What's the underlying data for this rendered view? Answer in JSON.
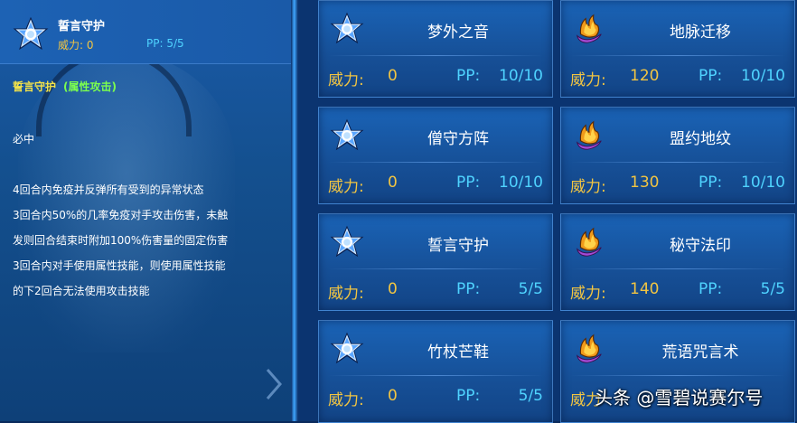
{
  "detail": {
    "skill_name": "誓言守护",
    "power_label": "威力: 0",
    "pp_label": "PP: 5/5",
    "desc_name": "誓言守护",
    "desc_type": "(属性攻击)",
    "lines": [
      "必中",
      "4回合内免疫并反弹所有受到的异常状态",
      "3回合内50%的几率免疫对手攻击伤害，未触",
      "发则回合结束时附加100%伤害量的固定伤害",
      "3回合内对手使用属性技能，则使用属性技能",
      "的下2回合无法使用攻击技能"
    ]
  },
  "cards": [
    {
      "name": "梦外之音",
      "icon": "star-emblem-icon",
      "power_label": "威力:",
      "power": "0",
      "pp_label": "PP:",
      "pp": "10/10"
    },
    {
      "name": "地脉迁移",
      "icon": "flame-claw-icon",
      "power_label": "威力:",
      "power": "120",
      "pp_label": "PP:",
      "pp": "10/10"
    },
    {
      "name": "僧守方阵",
      "icon": "star-emblem-icon",
      "power_label": "威力:",
      "power": "0",
      "pp_label": "PP:",
      "pp": "10/10"
    },
    {
      "name": "盟约地纹",
      "icon": "flame-claw-icon",
      "power_label": "威力:",
      "power": "130",
      "pp_label": "PP:",
      "pp": "10/10"
    },
    {
      "name": "誓言守护",
      "icon": "star-emblem-icon",
      "power_label": "威力:",
      "power": "0",
      "pp_label": "PP:",
      "pp": "5/5"
    },
    {
      "name": "秘守法印",
      "icon": "flame-claw-icon",
      "power_label": "威力:",
      "power": "140",
      "pp_label": "PP:",
      "pp": "5/5"
    },
    {
      "name": "竹杖芒鞋",
      "icon": "star-emblem-icon",
      "power_label": "威力:",
      "power": "0",
      "pp_label": "PP:",
      "pp": "5/5"
    },
    {
      "name": "荒语咒言术",
      "icon": "flame-claw-icon",
      "power_label": "威力",
      "power": "",
      "pp_label": "",
      "pp": ""
    }
  ],
  "watermark": "头条 @雪碧说赛尔号",
  "colors": {
    "power": "#f2c542",
    "pp": "#4fd3ff",
    "type_tag": "#7cff4e",
    "name_tag": "#f2e24a"
  }
}
